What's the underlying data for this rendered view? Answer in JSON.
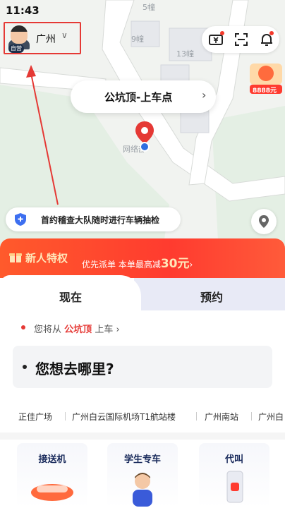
{
  "status": {
    "time": "11:43"
  },
  "map": {
    "labels": {
      "b5": "5幢",
      "b9": "9幢",
      "b13": "13幢",
      "poi": "网络部"
    }
  },
  "city": {
    "name": "广州",
    "badge": "自营",
    "chevron": "∨"
  },
  "promo": {
    "amount": "8888元"
  },
  "pickup": {
    "label": "公坑顶-上车点",
    "chevron": "›"
  },
  "notice": {
    "text": "首约稽查大队随时进行车辆抽检"
  },
  "banner": {
    "title": "新人特权",
    "sub": "优先派单 本单最高减",
    "amount": "30元",
    "chevron": "›"
  },
  "tabs": {
    "now": "现在",
    "reserve": "预约"
  },
  "from": {
    "prefix": "您将从",
    "place": "公坑顶",
    "suffix": "上车",
    "chevron": "›"
  },
  "destination": {
    "placeholder": "您想去哪里?"
  },
  "suggestions": [
    "正佳广场",
    "广州白云国际机场T1航站楼",
    "广州南站",
    "广州白"
  ],
  "services": [
    {
      "title": "接送机"
    },
    {
      "title": "学生专车"
    },
    {
      "title": "代叫"
    }
  ],
  "colors": {
    "accent": "#ff3b2f",
    "route": "#e53935",
    "pin": "#e53935"
  }
}
